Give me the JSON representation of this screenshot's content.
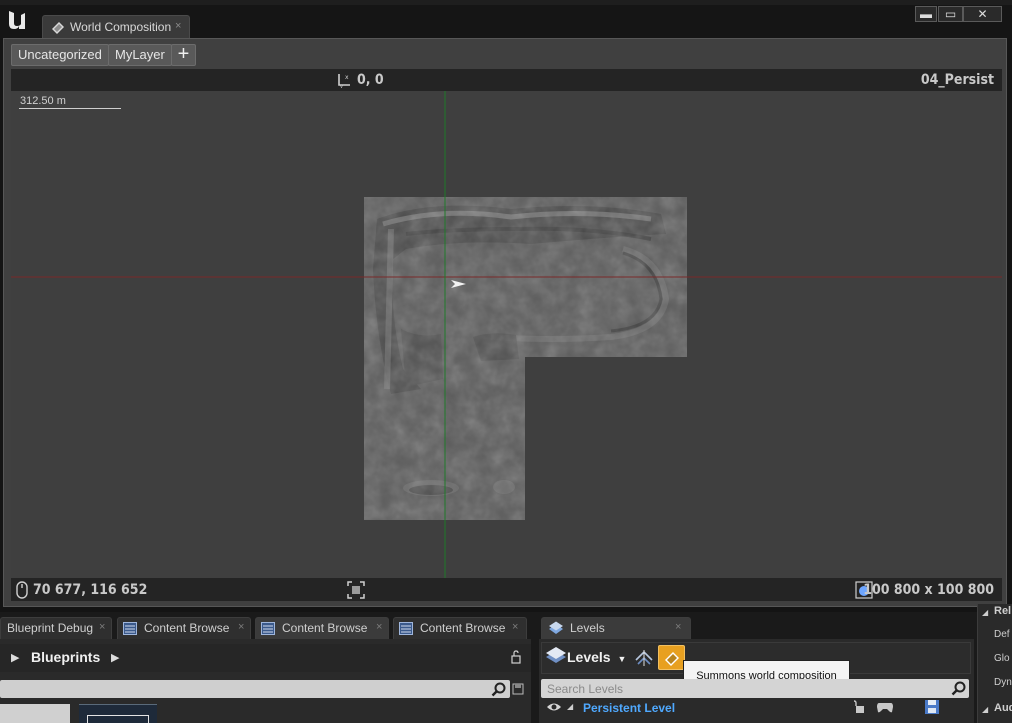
{
  "window": {
    "tab_title": "World Composition",
    "tab_close": "×",
    "controls": {
      "minimize": "▬",
      "maximize": "▭",
      "close": "✕"
    }
  },
  "layers": {
    "items": [
      "Uncategorized",
      "MyLayer"
    ],
    "add_label": "+"
  },
  "viewport": {
    "origin_readout": "0, 0",
    "level_name": "04_Persist",
    "scale_label": "312.50 m",
    "mouse_coords": "70 677, 116 652",
    "world_size": "100 800 x 100 800"
  },
  "bottom_tabs": [
    {
      "label": "Blueprint Debug",
      "close": "×"
    },
    {
      "label": "Content Browse",
      "close": "×"
    },
    {
      "label": "Content Browse",
      "close": "×"
    },
    {
      "label": "Content Browse",
      "close": "×"
    }
  ],
  "content_browser": {
    "path": "Blueprints"
  },
  "levels": {
    "tab_label": "Levels",
    "tab_close": "×",
    "menu_label": "Levels",
    "search_placeholder": "Search Levels",
    "persistent_level": "Persistent Level",
    "tooltip": "Summons world composition"
  },
  "right_panel": {
    "items": [
      "Rel",
      "Def",
      "Glo",
      "Dyn",
      "Aud"
    ]
  },
  "colors": {
    "accent_blue": "#4fa9ff",
    "highlight_orange": "#e8a020",
    "axis_red": "#7a2a2a",
    "axis_green": "#1f7a2a"
  }
}
